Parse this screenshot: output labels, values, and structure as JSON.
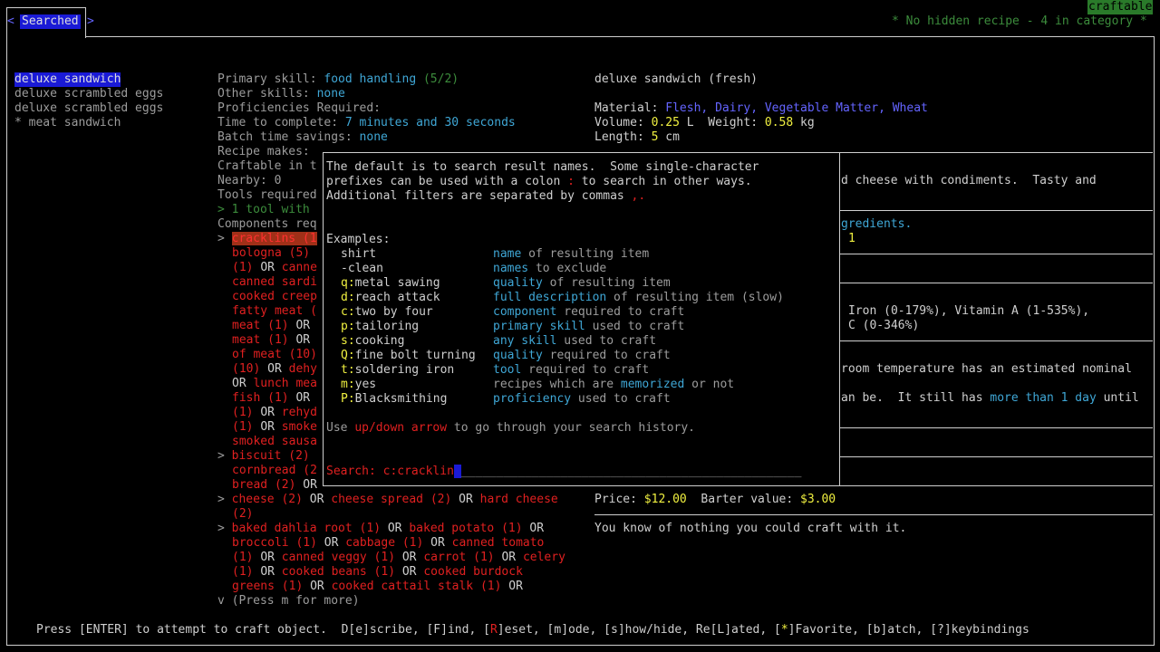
{
  "tab": {
    "left_arrow": "<",
    "label": "Searched",
    "right_arrow": ">"
  },
  "craftable_badge": "craftable",
  "hidden_note": "* No hidden recipe - 4 in category *",
  "recipes": [
    {
      "label": "deluxe sandwich",
      "selected": true
    },
    {
      "label": "deluxe scrambled eggs",
      "selected": false
    },
    {
      "label": "deluxe scrambled eggs",
      "selected": false
    },
    {
      "label": "* meat sandwich",
      "selected": false
    }
  ],
  "detail": {
    "primary_label": "Primary skill:",
    "primary_value": "food handling",
    "primary_level": "(5/2)",
    "other_label": "Other skills:",
    "other_value": "none",
    "prof_label": "Proficiencies Required:",
    "time_label": "Time to complete:",
    "time_value": "7 minutes and 30 seconds",
    "batch_label": "Batch time savings:",
    "batch_value": "none",
    "makes_label": "Recipe makes:",
    "craftable_label": "Craftable in t",
    "nearby_label": "Nearby: 0",
    "tools_label": "Tools required",
    "tool_line": "> 1 tool with",
    "comp_label": "Components req",
    "comp1": "> ",
    "comp1_item": "cracklins (1",
    "bologna": "bologna (5)",
    "canne_or": "OR",
    "canne": "canne",
    "canne_pre": "(1)",
    "canned_sardi": "canned sardi",
    "cooked_creep": "cooked creep",
    "fatty_meat": "fatty meat (",
    "meat1": "meat (1)",
    "meat1_or": "OR",
    "meat2": "meat (1)",
    "meat2_or": "OR",
    "of_meat": "of meat (10)",
    "ten": "(10)",
    "ten_or": "OR",
    "dehy": "dehy",
    "lunch_or": "OR",
    "lunch": "lunch mea",
    "fish": "fish (1)",
    "fish_or": "OR",
    "rehyd_pre": "(1)",
    "rehyd_or": "OR",
    "rehyd": "rehyd",
    "smoke_pre": "(1)",
    "smoke_or": "OR",
    "smoke": "smoke",
    "smoked_sausa": "smoked sausa",
    "biscuit_arrow": "> ",
    "biscuit": "biscuit (2)",
    "cornbread": "cornbread (2",
    "bread": "bread (2)",
    "bread_or": "OR",
    "cheese_arrow": "> ",
    "cheese": "cheese (2)",
    "cheese_or1": "OR",
    "cheese_spread": "cheese spread (2)",
    "cheese_or2": "OR",
    "hard_cheese": "hard cheese",
    "cheese_cont": "(2)",
    "veg_arrow": "> ",
    "veg1a": "baked dahlia root (1)",
    "veg1_or1": "OR",
    "veg1b": "baked potato (1)",
    "veg1_or2": "OR",
    "veg2a": "broccoli (1)",
    "veg2_or1": "OR",
    "veg2b": "cabbage (1)",
    "veg2_or2": "OR",
    "veg2c": "canned tomato",
    "veg3a": "(1)",
    "veg3_or1": "OR",
    "veg3b": "canned veggy (1)",
    "veg3_or2": "OR",
    "veg3c": "carrot (1)",
    "veg3_or3": "OR",
    "veg3d": "celery",
    "veg4a": "(1)",
    "veg4_or1": "OR",
    "veg4b": "cooked beans (1)",
    "veg4_or2": "OR",
    "veg4c": "cooked burdock",
    "veg5a": "greens (1)",
    "veg5_or1": "OR",
    "veg5b": "cooked cattail stalk (1)",
    "veg5_or2": "OR",
    "more": "v (Press m for more)"
  },
  "item": {
    "title": "deluxe sandwich (fresh)",
    "material_label": "Material:",
    "materials": "Flesh, Dairy, Vegetable Matter, Wheat",
    "volume_label": "Volume:",
    "volume": "0.25",
    "volume_unit": "L",
    "weight_label": "Weight:",
    "weight": "0.58",
    "weight_unit": "kg",
    "length_label": "Length:",
    "length": "5",
    "length_unit": "cm",
    "desc_frag": "d cheese with condiments.  Tasty and",
    "ingr_frag": "gredients.",
    "ingr_num": "1",
    "vit_frag1": "Iron (0-179%), Vitamin A (1-535%),",
    "vit_frag2": "C (0-346%)",
    "room_frag": "room temperature has an estimated nominal",
    "still_frag": "an be.  It still has ",
    "more_than": "more than 1 day",
    "until": " until",
    "price_label": "Price:",
    "price": "$12.00",
    "barter_label": "Barter value:",
    "barter": "$3.00",
    "know": "You know of nothing you could craft with it."
  },
  "popup": {
    "intro1": "The default is to search result names.  Some single-character",
    "intro2a": "prefixes can be used with a colon ",
    "colon": ":",
    "intro2b": " to search in other ways.",
    "intro3a": "Additional filters are separated by commas ",
    "commas": ",.",
    "examples_label": "Examples:",
    "examples": [
      {
        "key": "shirt",
        "desc_hl": "name",
        "desc": " of resulting item"
      },
      {
        "key": "-clean",
        "desc_hl": "names",
        "desc": " to exclude"
      },
      {
        "key": "metal sawing",
        "prefix": "q:",
        "desc_hl": "quality",
        "desc": " of resulting item"
      },
      {
        "key": "reach attack",
        "prefix": "d:",
        "desc_hl": "full description",
        "desc": " of resulting item (slow)"
      },
      {
        "key": "two by four",
        "prefix": "c:",
        "desc_hl": "component",
        "desc": " required to craft"
      },
      {
        "key": "tailoring",
        "prefix": "p:",
        "desc_hl": "primary skill",
        "desc": " used to craft"
      },
      {
        "key": "cooking",
        "prefix": "s:",
        "desc_hl": "any skill",
        "desc": " used to craft"
      },
      {
        "key": "fine bolt turning",
        "prefix": "Q:",
        "desc_hl": "quality",
        "desc": " required to craft"
      },
      {
        "key": "soldering iron",
        "prefix": "t:",
        "desc_hl": "tool",
        "desc": " required to craft"
      },
      {
        "key": "yes",
        "prefix": "m:",
        "desc_pre": "recipes which are ",
        "desc_hl": "memorized",
        "desc": " or not"
      },
      {
        "key": "Blacksmithing",
        "prefix": "P:",
        "desc_hl": "proficiency",
        "desc": " used to craft"
      }
    ],
    "history_a": "Use ",
    "history_hl": "up/down arrow",
    "history_b": " to go through your search history.",
    "search_label": "Search:",
    "search_value": "c:cracklin",
    "search_fill": "________________________________________________"
  },
  "footer": {
    "a": "Press ",
    "enter": "[ENTER]",
    "b": " to attempt to craft object.  D[e]scribe, [F]ind, [",
    "R": "R",
    "c": "]eset, [m]ode, [s]how/hide, Re[L]ated, [",
    "star": "*",
    "d": "]Favorite, [b]atch, [?]keybindings"
  }
}
